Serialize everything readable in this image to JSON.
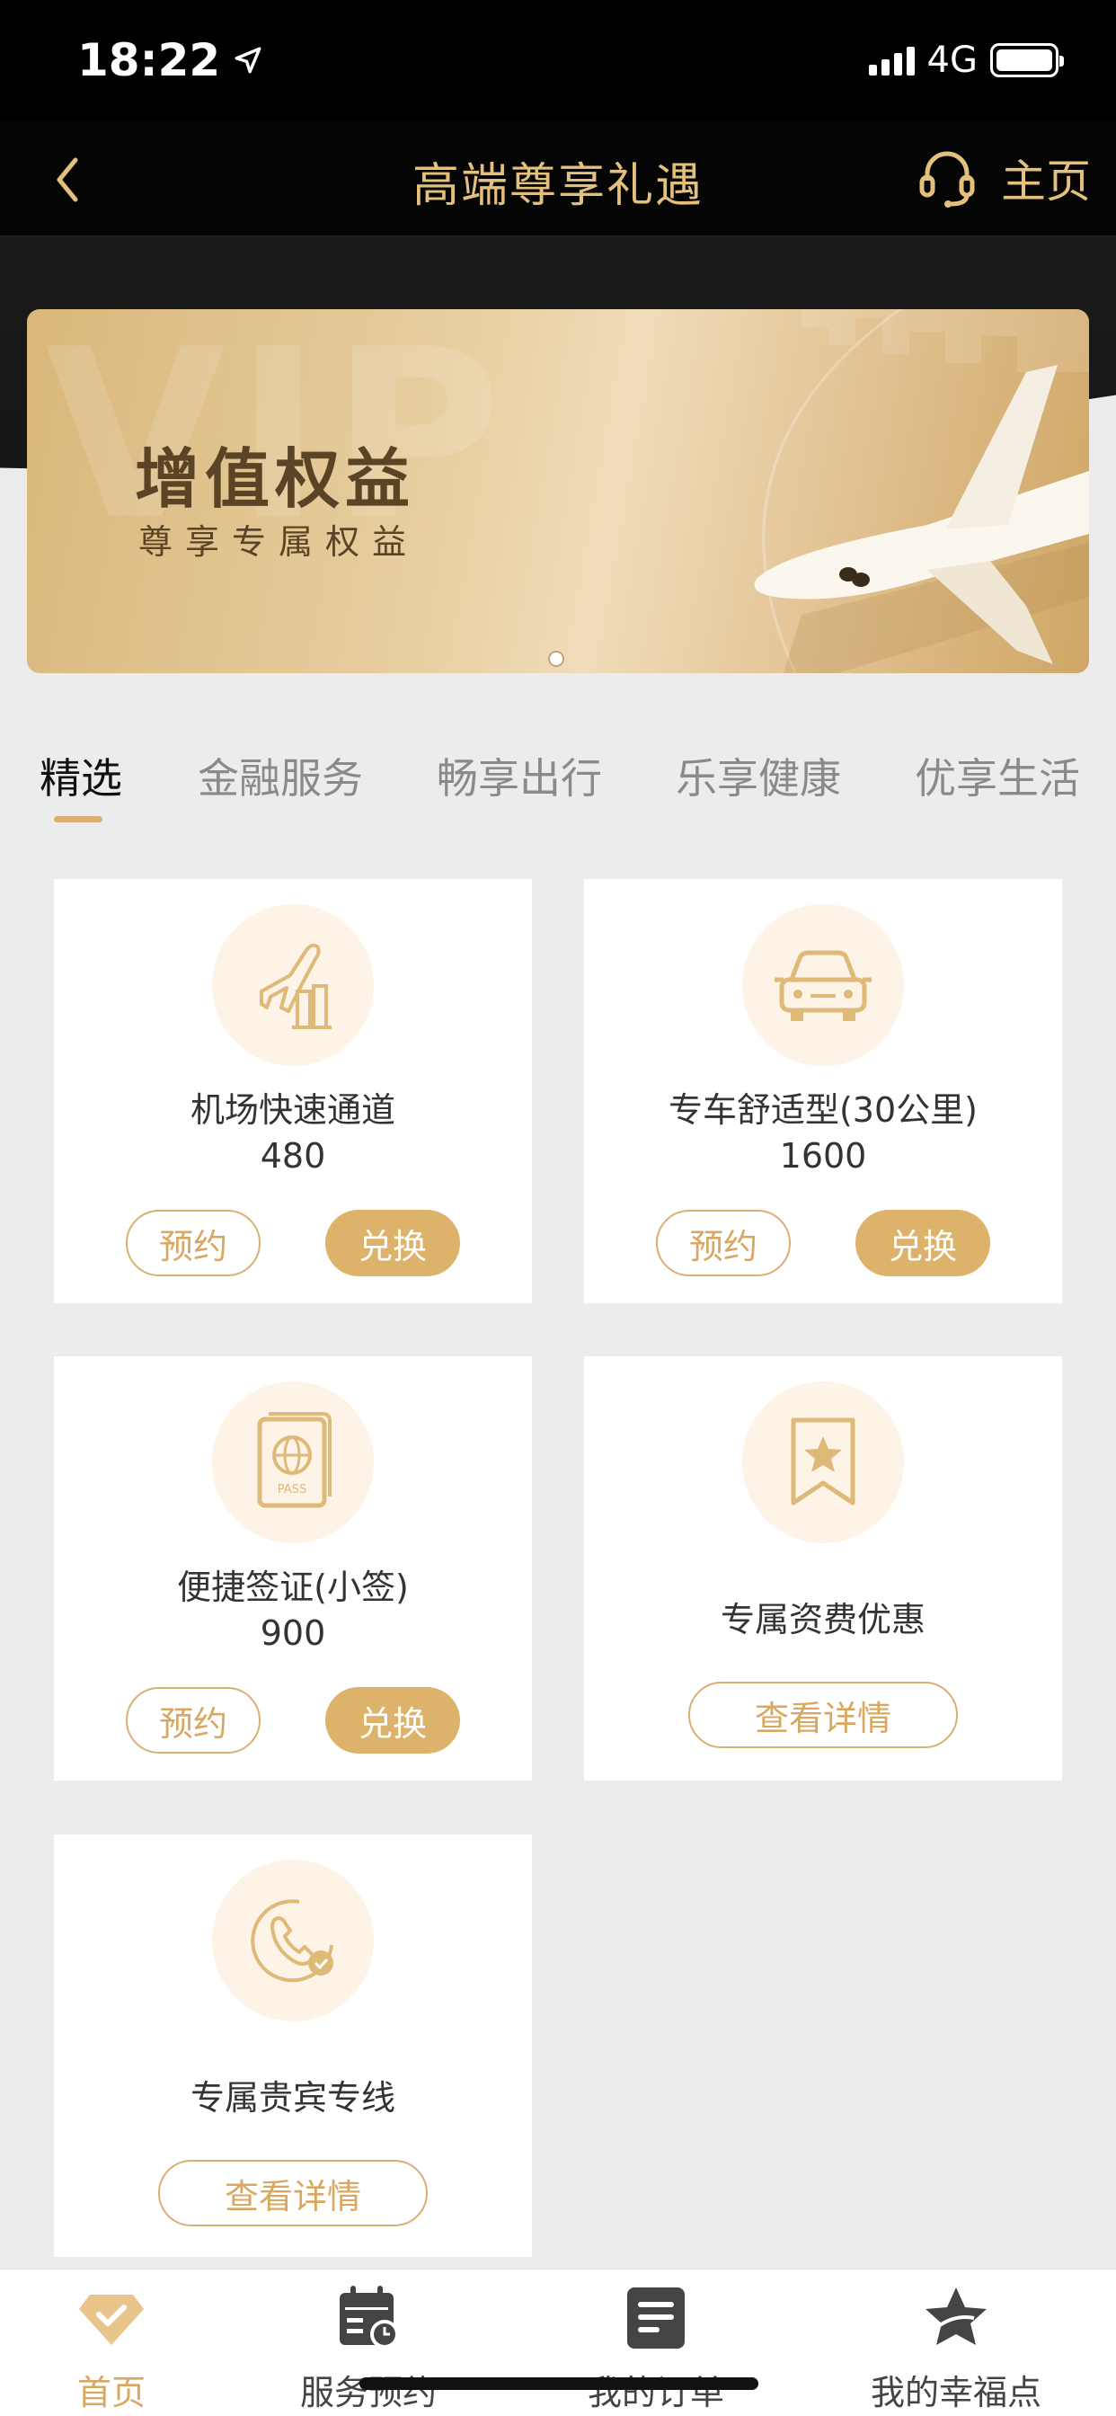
{
  "status_bar": {
    "time": "18:22",
    "network": "4G"
  },
  "nav": {
    "title": "高端尊享礼遇",
    "home_label": "主页"
  },
  "banner": {
    "watermark": "VIP",
    "title": "增值权益",
    "subtitle": "尊享专属权益"
  },
  "tabs": [
    {
      "label": "精选",
      "active": true
    },
    {
      "label": "金融服务",
      "active": false
    },
    {
      "label": "畅享出行",
      "active": false
    },
    {
      "label": "乐享健康",
      "active": false
    },
    {
      "label": "优享生活",
      "active": false
    }
  ],
  "cards": [
    {
      "name": "机场快速通道",
      "points": "480",
      "reserve_label": "预约",
      "redeem_label": "兑换",
      "icon": "airplane-fast-track-icon"
    },
    {
      "name": "专车舒适型(30公里)",
      "points": "1600",
      "reserve_label": "预约",
      "redeem_label": "兑换",
      "icon": "car-icon"
    },
    {
      "name": "便捷签证(小签)",
      "points": "900",
      "reserve_label": "预约",
      "redeem_label": "兑换",
      "icon": "passport-icon"
    },
    {
      "name": "专属资费优惠",
      "detail_label": "查看详情",
      "icon": "star-bookmark-icon"
    },
    {
      "name": "专属贵宾专线",
      "detail_label": "查看详情",
      "icon": "vip-phone-icon"
    }
  ],
  "tabbar": [
    {
      "label": "首页",
      "active": true,
      "icon": "home-diamond-icon"
    },
    {
      "label": "服务预约",
      "active": false,
      "icon": "calendar-clock-icon"
    },
    {
      "label": "我的订单",
      "active": false,
      "icon": "order-list-icon"
    },
    {
      "label": "我的幸福点",
      "active": false,
      "icon": "star-points-icon"
    }
  ],
  "colors": {
    "gold": "#DDB36C",
    "gold_text": "#E3C07C",
    "icon_bg": "#FDF3E6"
  }
}
